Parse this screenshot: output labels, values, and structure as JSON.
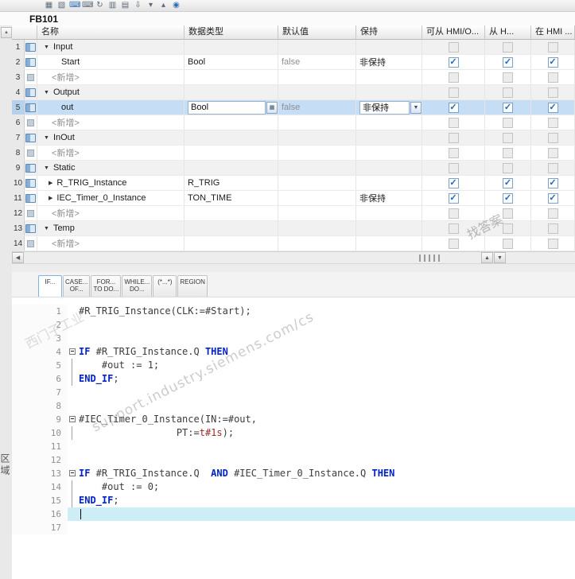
{
  "window": {
    "title": "FB101"
  },
  "toolbar": {
    "icons": [
      {
        "name": "insert-row-icon",
        "glyph": "▦",
        "accent": false
      },
      {
        "name": "add-row-icon",
        "glyph": "▧",
        "accent": false
      },
      {
        "name": "keyboard-icon",
        "glyph": "⌨",
        "accent": true
      },
      {
        "name": "ergonomic-keyboard-icon",
        "glyph": "⌨",
        "accent": false
      },
      {
        "name": "reset-start-values-icon",
        "glyph": "↻",
        "accent": false
      },
      {
        "name": "snapshot-icon",
        "glyph": "▥",
        "accent": false
      },
      {
        "name": "copy-snapshot-icon",
        "glyph": "▤",
        "accent": false
      },
      {
        "name": "load-values-icon",
        "glyph": "⇩",
        "accent": false
      },
      {
        "name": "expand-all-icon",
        "glyph": "▾",
        "accent": false
      },
      {
        "name": "collapse-all-icon",
        "glyph": "▴",
        "accent": false
      },
      {
        "name": "monitor-all-icon",
        "glyph": "◉",
        "accent": true
      }
    ]
  },
  "table": {
    "headers": {
      "name": "名称",
      "data_type": "数据类型",
      "default_value": "默认值",
      "retain": "保持",
      "acc_hmi": "可从 HMI/O...",
      "from_hmi": "从 H...",
      "in_hmi": "在 HMI ..."
    },
    "rows": [
      {
        "num": "1",
        "kind": "section",
        "name": "Input"
      },
      {
        "num": "2",
        "kind": "var",
        "name": "Start",
        "type": "Bool",
        "def": "false",
        "retain": "非保持",
        "hmi": true
      },
      {
        "num": "3",
        "kind": "add",
        "name": "<新增>"
      },
      {
        "num": "4",
        "kind": "section",
        "name": "Output"
      },
      {
        "num": "5",
        "kind": "var",
        "sel": true,
        "name": "out",
        "type": "Bool",
        "def": "false",
        "retain": "非保持",
        "hmi": true
      },
      {
        "num": "6",
        "kind": "add",
        "name": "<新增>"
      },
      {
        "num": "7",
        "kind": "section",
        "name": "InOut"
      },
      {
        "num": "8",
        "kind": "add",
        "name": "<新增>"
      },
      {
        "num": "9",
        "kind": "section",
        "name": "Static"
      },
      {
        "num": "10",
        "kind": "var",
        "struct": true,
        "name": "R_TRIG_Instance",
        "type": "R_TRIG",
        "hmi": true
      },
      {
        "num": "11",
        "kind": "var",
        "struct": true,
        "name": "IEC_Timer_0_Instance",
        "type": "TON_TIME",
        "retain": "非保持",
        "hmi": true
      },
      {
        "num": "12",
        "kind": "add",
        "name": "<新增>"
      },
      {
        "num": "13",
        "kind": "section",
        "name": "Temp"
      },
      {
        "num": "14",
        "kind": "add",
        "name": "<新增>"
      }
    ]
  },
  "splitter": {
    "left": "◀",
    "up": "▲",
    "down": "▼",
    "scroll_up": "▲"
  },
  "snippets": [
    {
      "id": "if",
      "lines": [
        "IF..."
      ],
      "active": true
    },
    {
      "id": "case",
      "lines": [
        "CASE...",
        "OF..."
      ],
      "active": false
    },
    {
      "id": "for",
      "lines": [
        "FOR...",
        "TO DO..."
      ],
      "active": false
    },
    {
      "id": "while",
      "lines": [
        "WHILE...",
        "DO..."
      ],
      "active": false
    },
    {
      "id": "comment",
      "lines": [
        "(*...*)"
      ],
      "active": false
    },
    {
      "id": "region",
      "lines": [
        "REGION"
      ],
      "active": false
    }
  ],
  "code": {
    "lines": [
      {
        "n": 1,
        "segs": [
          [
            "p",
            "#R_TRIG_Instance(CLK:=#Start);"
          ]
        ]
      },
      {
        "n": 2
      },
      {
        "n": 3
      },
      {
        "n": 4,
        "fold": "box",
        "segs": [
          [
            "k",
            "IF"
          ],
          [
            "p",
            " #R_TRIG_Instance.Q "
          ],
          [
            "k",
            "THEN"
          ]
        ]
      },
      {
        "n": 5,
        "fold": "bar",
        "segs": [
          [
            "p",
            "    #out := 1;"
          ]
        ]
      },
      {
        "n": 6,
        "fold": "bar",
        "segs": [
          [
            "k",
            "END_IF"
          ],
          [
            "p",
            ";"
          ]
        ]
      },
      {
        "n": 7
      },
      {
        "n": 8
      },
      {
        "n": 9,
        "fold": "box",
        "segs": [
          [
            "p",
            "#IEC_Timer_0_Instance(IN:=#out,"
          ]
        ]
      },
      {
        "n": 10,
        "fold": "bar",
        "segs": [
          [
            "p",
            "                 PT:="
          ],
          [
            "t",
            "t#1s"
          ],
          [
            "p",
            ");"
          ]
        ]
      },
      {
        "n": 11
      },
      {
        "n": 12
      },
      {
        "n": 13,
        "fold": "box",
        "segs": [
          [
            "k",
            "IF"
          ],
          [
            "p",
            " #R_TRIG_Instance.Q  "
          ],
          [
            "k",
            "AND"
          ],
          [
            "p",
            " #IEC_Timer_0_Instance.Q "
          ],
          [
            "k",
            "THEN"
          ]
        ]
      },
      {
        "n": 14,
        "fold": "bar",
        "segs": [
          [
            "p",
            "    #out := 0;"
          ]
        ]
      },
      {
        "n": 15,
        "fold": "bar",
        "segs": [
          [
            "k",
            "END_IF"
          ],
          [
            "p",
            ";"
          ]
        ]
      },
      {
        "n": 16,
        "hl": true,
        "cursor": true
      },
      {
        "n": 17
      }
    ]
  },
  "watermark": {
    "brand": "西门子工业",
    "domain": "support.industry.siemens.com/cs",
    "tag": "找答案",
    "side": "区域"
  }
}
